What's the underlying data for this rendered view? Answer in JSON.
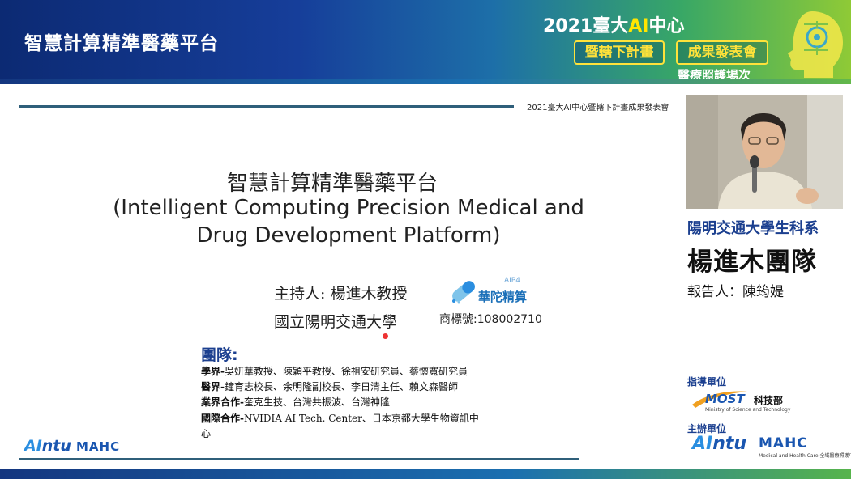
{
  "banner": {
    "title": "智慧計算精準醫藥平台",
    "event_year": "2021臺大",
    "event_ai": "AI",
    "event_center": "中心",
    "pill_a": "暨轄下計畫",
    "pill_b": "成果發表會",
    "subtitle": "醫療照護場次"
  },
  "slide": {
    "header_text": "2021臺大AI中心暨轄下計畫成果發表會",
    "title_zh": "智慧計算精準醫藥平台",
    "title_en_1": "(Intelligent Computing Precision Medical and",
    "title_en_2": "Drug Development Platform)",
    "host": "主持人: 楊進木教授",
    "institution": "國立陽明交通大學",
    "brand_name": "華陀精算",
    "brand_sup": "AIP4",
    "trademark": "商標號:108002710",
    "team_heading": "團隊:",
    "team": [
      {
        "key": "學界-",
        "text": "吳妍華教授、陳穎平教授、徐祖安研究員、蔡懷寬研究員"
      },
      {
        "key": "醫界-",
        "text": "鐘育志校長、余明隆副校長、李日清主任、賴文森醫師"
      },
      {
        "key": "業界合作-",
        "text": "奎克生技、台灣共振波、台灣神隆"
      },
      {
        "key": "國際合作-",
        "text": "NVIDIA AI Tech. Center、日本京都大學生物資訊中"
      },
      {
        "key": "",
        "text": "心"
      }
    ],
    "footer_ai": "AI",
    "footer_ntu": "ntu",
    "footer_mahe": "MAHC"
  },
  "panel": {
    "affiliation": "陽明交通大學生科系",
    "team_name": "楊進木團隊",
    "reporter": "報告人：陳筠媞",
    "guide_label": "指導單位",
    "most": "MOST",
    "most_zh": "科技部",
    "most_sub": "Ministry of Science and Technology",
    "host_label": "主辦單位",
    "ai": "AI",
    "ntu": "ntu",
    "mahe": "MAHC",
    "mahe_sub": "Medical and Health Care 全域醫療照護中心"
  },
  "colors": {
    "banner_dark": "#0c2a73",
    "banner_green": "#8fca36",
    "accent_yellow": "#ffe23a",
    "heading_blue": "#1b3f8f"
  }
}
